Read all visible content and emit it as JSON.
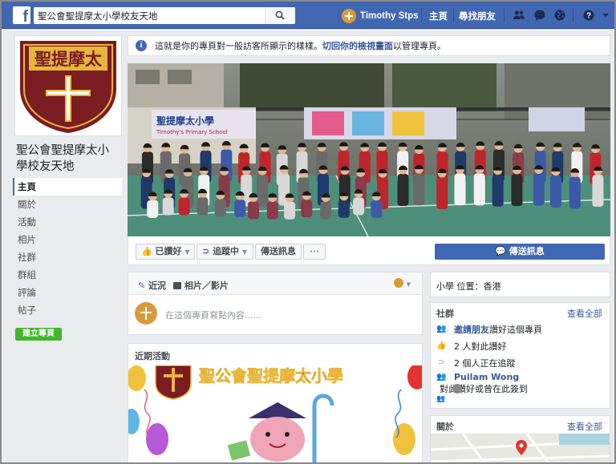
{
  "topbar": {
    "logo": "f",
    "search_value": "聖公會聖提摩太小學校友天地",
    "user_name": "Timothy Stps",
    "nav_home": "主頁",
    "nav_find_friends": "尋找朋友",
    "icons": [
      "friend-requests-icon",
      "messages-icon",
      "notifications-icon",
      "help-icon",
      "dropdown-icon"
    ]
  },
  "profile": {
    "badge_text": "聖提摩太",
    "page_name": "聖公會聖提摩太小學校友天地"
  },
  "leftnav": {
    "items": [
      "主頁",
      "關於",
      "活動",
      "相片",
      "社群",
      "群組",
      "評論",
      "帖子"
    ],
    "active_index": 0,
    "create_page": "建立專頁"
  },
  "notice": {
    "text": "這就是你的專頁對一般訪客所顯示的樣樣。",
    "link": "切回你的檢視畫面",
    "tail": "以管理專頁。"
  },
  "cover": {
    "banner_left": "聖提摩太小學",
    "banner_left_sub": "Timothy's Primary School"
  },
  "actions": {
    "like": "已讚好",
    "follow": "追蹤中",
    "message": "傳送訊息",
    "more": "···",
    "send_message": "傳送訊息"
  },
  "composer": {
    "tab_status": "近況",
    "tab_photo": "相片／影片",
    "placeholder": "在這個專頁寫點內容......"
  },
  "recent": {
    "title": "近期活動",
    "banner_text": "聖公會聖提摩太小學"
  },
  "sidebar": {
    "school_type": "小學 位置：香港",
    "community_title": "社群",
    "see_all": "查看全部",
    "invite_link": "邀請朋友",
    "invite_text": "讚好這個專頁",
    "likes_text": "2 人對此讚好",
    "follows_text": "2 個人正在追蹤",
    "friend_name": "Puilam Wong",
    "friend_text": "對此讚好或曾在此簽到",
    "about_title": "關於",
    "about_see_all": "查看全部"
  },
  "colors": {
    "brand": "#4267b2",
    "link": "#365899",
    "green": "#42b72a",
    "page_bg": "#e9ebee"
  }
}
